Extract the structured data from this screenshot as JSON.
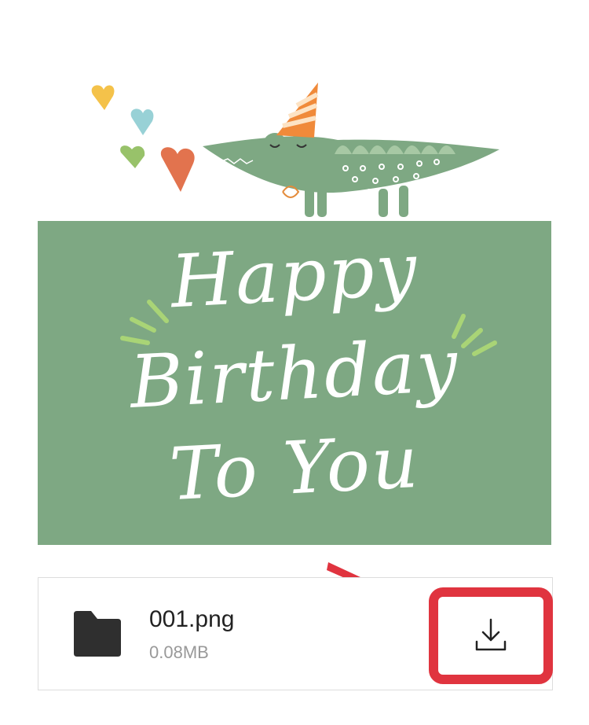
{
  "card": {
    "line1": "Happy",
    "line2": "Birthday",
    "line3": "To You",
    "panel_color": "#7ea883"
  },
  "file": {
    "name": "001.png",
    "size": "0.08MB",
    "icon": "folder-icon"
  },
  "download": {
    "icon": "download-icon",
    "highlight_color": "#e0343f"
  }
}
